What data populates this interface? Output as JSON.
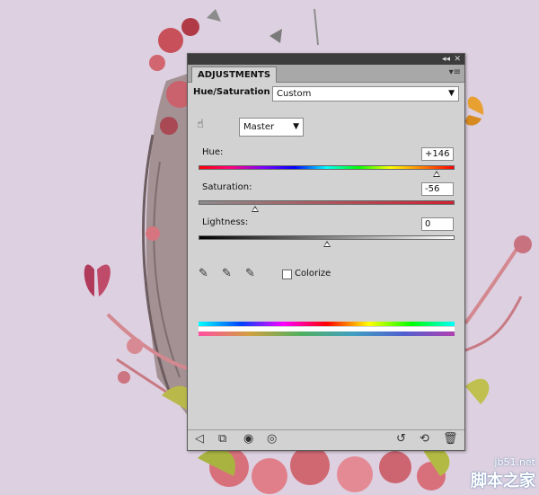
{
  "panel": {
    "tab_label": "ADJUSTMENTS",
    "adjustment_type": "Hue/Saturation",
    "preset": "Custom",
    "channel": "Master",
    "hue": {
      "label": "Hue:",
      "value": "+146",
      "fraction": 0.93
    },
    "saturation": {
      "label": "Saturation:",
      "value": "-56",
      "fraction": 0.22
    },
    "lightness": {
      "label": "Lightness:",
      "value": "0",
      "fraction": 0.5
    },
    "colorize_label": "Colorize",
    "colorize_checked": false
  },
  "icons": {
    "titlebar": [
      "collapse-icon",
      "close-icon"
    ],
    "panel_menu": "panel-menu-icon",
    "targeted_adjust": "hand-adjust-icon",
    "eyedroppers": [
      "eyedropper-icon",
      "eyedropper-plus-icon",
      "eyedropper-minus-icon"
    ],
    "bottom": [
      "back-arrow-icon",
      "clip-to-layer-icon",
      "layer-visibility-circle-icon",
      "eye-icon",
      "view-previous-icon",
      "reset-icon",
      "trash-icon"
    ]
  },
  "watermark": {
    "url": "jb51.net",
    "cn": "脚本之家"
  }
}
